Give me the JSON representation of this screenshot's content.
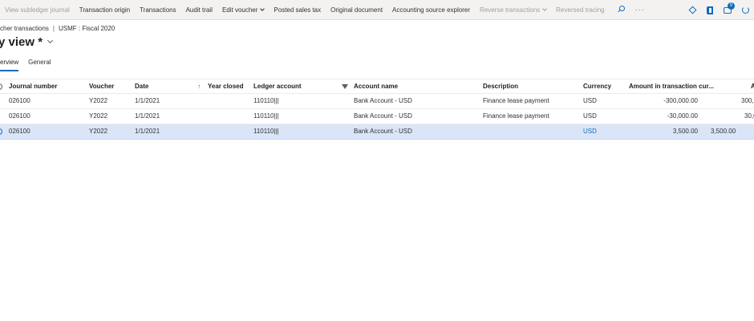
{
  "actionbar": {
    "items": [
      {
        "label": "View subledger journal",
        "disabled": true
      },
      {
        "label": "Transaction origin",
        "disabled": false
      },
      {
        "label": "Transactions",
        "disabled": false
      },
      {
        "label": "Audit trail",
        "disabled": false
      },
      {
        "label": "Edit voucher",
        "disabled": false
      },
      {
        "label": "Posted sales tax",
        "disabled": false
      },
      {
        "label": "Original document",
        "disabled": false
      },
      {
        "label": "Accounting source explorer",
        "disabled": false
      },
      {
        "label": "Reverse transactions",
        "disabled": true
      },
      {
        "label": "Reversed tracing",
        "disabled": true
      }
    ],
    "more": "···",
    "notification_count": "0"
  },
  "header": {
    "breadcrumb_page": "cher transactions",
    "breadcrumb_context": "USMF : Fiscal 2020",
    "breadcrumb_separator": "|",
    "title": "y view *"
  },
  "tabs": [
    {
      "label": "erview",
      "active": true
    },
    {
      "label": "General",
      "active": false
    }
  ],
  "grid": {
    "columns": {
      "journal": "Journal number",
      "voucher": "Voucher",
      "date": "Date",
      "year_closed": "Year closed",
      "ledger_account": "Ledger account",
      "account_name": "Account name",
      "description": "Description",
      "currency": "Currency",
      "amount_tc": "Amount in transaction cur...",
      "amount": "A"
    },
    "sort_arrow": "↑",
    "rows": [
      {
        "journal": "026100",
        "voucher": "Y2022",
        "date": "1/1/2021",
        "year_closed": "",
        "ledger_account": "110110|||",
        "account_name": "Bank Account - USD",
        "description": "Finance lease payment",
        "currency": "USD",
        "amount_tc": "-300,000.00",
        "amount": "300,0",
        "selected": false
      },
      {
        "journal": "026100",
        "voucher": "Y2022",
        "date": "1/1/2021",
        "year_closed": "",
        "ledger_account": "110110|||",
        "account_name": "Bank Account - USD",
        "description": "Finance lease payment",
        "currency": "USD",
        "amount_tc": "-30,000.00",
        "amount": "30,0",
        "selected": false
      },
      {
        "journal": "026100",
        "voucher": "Y2022",
        "date": "1/1/2021",
        "year_closed": "",
        "ledger_account": "110110|||",
        "account_name": "Bank Account - USD",
        "description": "",
        "currency": "USD",
        "amount_tc": "3,500.00",
        "amount": "3,500.00",
        "selected": true
      }
    ]
  }
}
